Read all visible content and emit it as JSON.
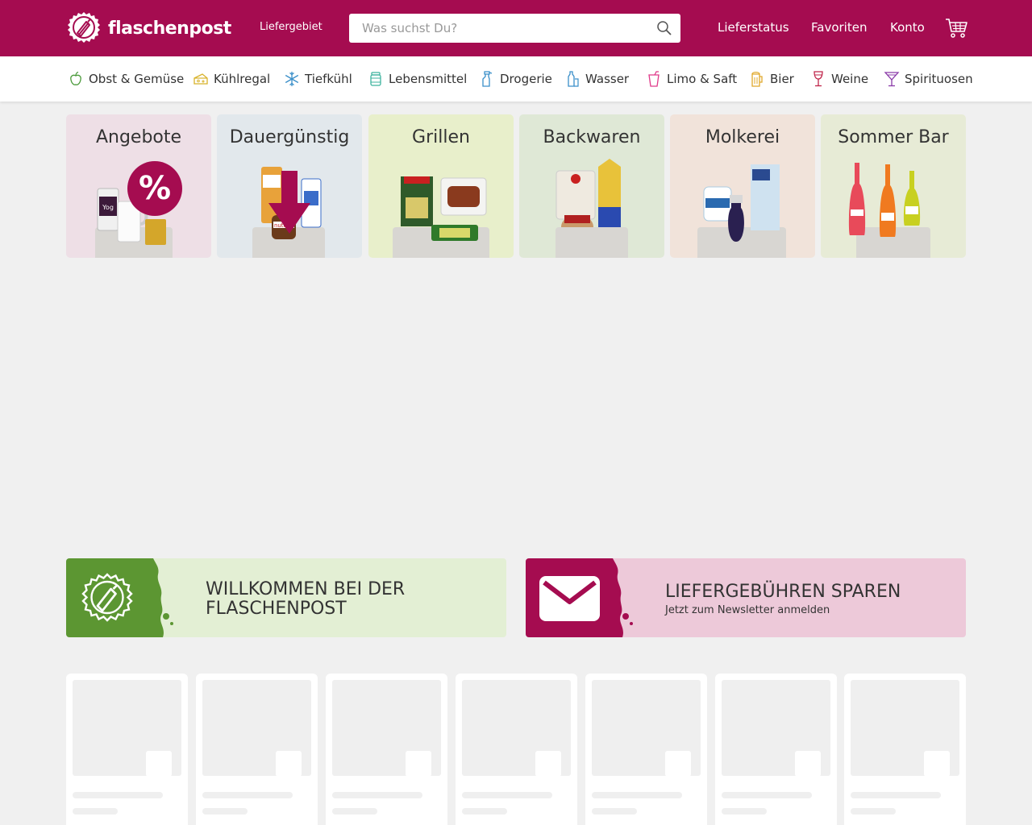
{
  "header": {
    "brand": "flaschenpost",
    "delivery_area": "Liefergebiet",
    "search_placeholder": "Was suchst Du?",
    "nav": [
      "Lieferstatus",
      "Favoriten",
      "Konto"
    ],
    "brand_color": "#a50c50"
  },
  "categories": [
    {
      "label": "Obst & Gemüse",
      "icon": "apple-icon",
      "color": "#4a9a3a"
    },
    {
      "label": "Kühlregal",
      "icon": "cheese-icon",
      "color": "#d8b22a"
    },
    {
      "label": "Tiefkühl",
      "icon": "snowflake-icon",
      "color": "#3a8fc9"
    },
    {
      "label": "Lebensmittel",
      "icon": "jar-icon",
      "color": "#3db39e"
    },
    {
      "label": "Drogerie",
      "icon": "spray-bottle-icon",
      "color": "#3a8fc9"
    },
    {
      "label": "Wasser",
      "icon": "water-bottle-icon",
      "color": "#3a8fc9"
    },
    {
      "label": "Limo & Saft",
      "icon": "cup-icon",
      "color": "#e03a8a"
    },
    {
      "label": "Bier",
      "icon": "beer-icon",
      "color": "#e0a82a"
    },
    {
      "label": "Weine",
      "icon": "wine-glass-icon",
      "color": "#c0254a"
    },
    {
      "label": "Spirituosen",
      "icon": "cocktail-icon",
      "color": "#8a3aa8"
    }
  ],
  "tiles": [
    {
      "title": "Angebote",
      "bg": "#eedfe6",
      "badge": "%"
    },
    {
      "title": "Dauergünstig",
      "bg": "#e2e8ec"
    },
    {
      "title": "Grillen",
      "bg": "#e8efcb"
    },
    {
      "title": "Backwaren",
      "bg": "#dfe8d6"
    },
    {
      "title": "Molkerei",
      "bg": "#f1e3da"
    },
    {
      "title": "Sommer Bar",
      "bg": "#e7ebd6"
    }
  ],
  "banners": [
    {
      "title_line1": "WILLKOMMEN BEI DER",
      "title_line2": "FLASCHENPOST",
      "bg": "#e3efd4",
      "accent": "#5c9632"
    },
    {
      "title_line1": "LIEFERGEBÜHREN SPAREN",
      "subtitle": "Jetzt zum Newsletter anmelden",
      "bg": "#edc9d9",
      "accent": "#a50c50"
    }
  ]
}
